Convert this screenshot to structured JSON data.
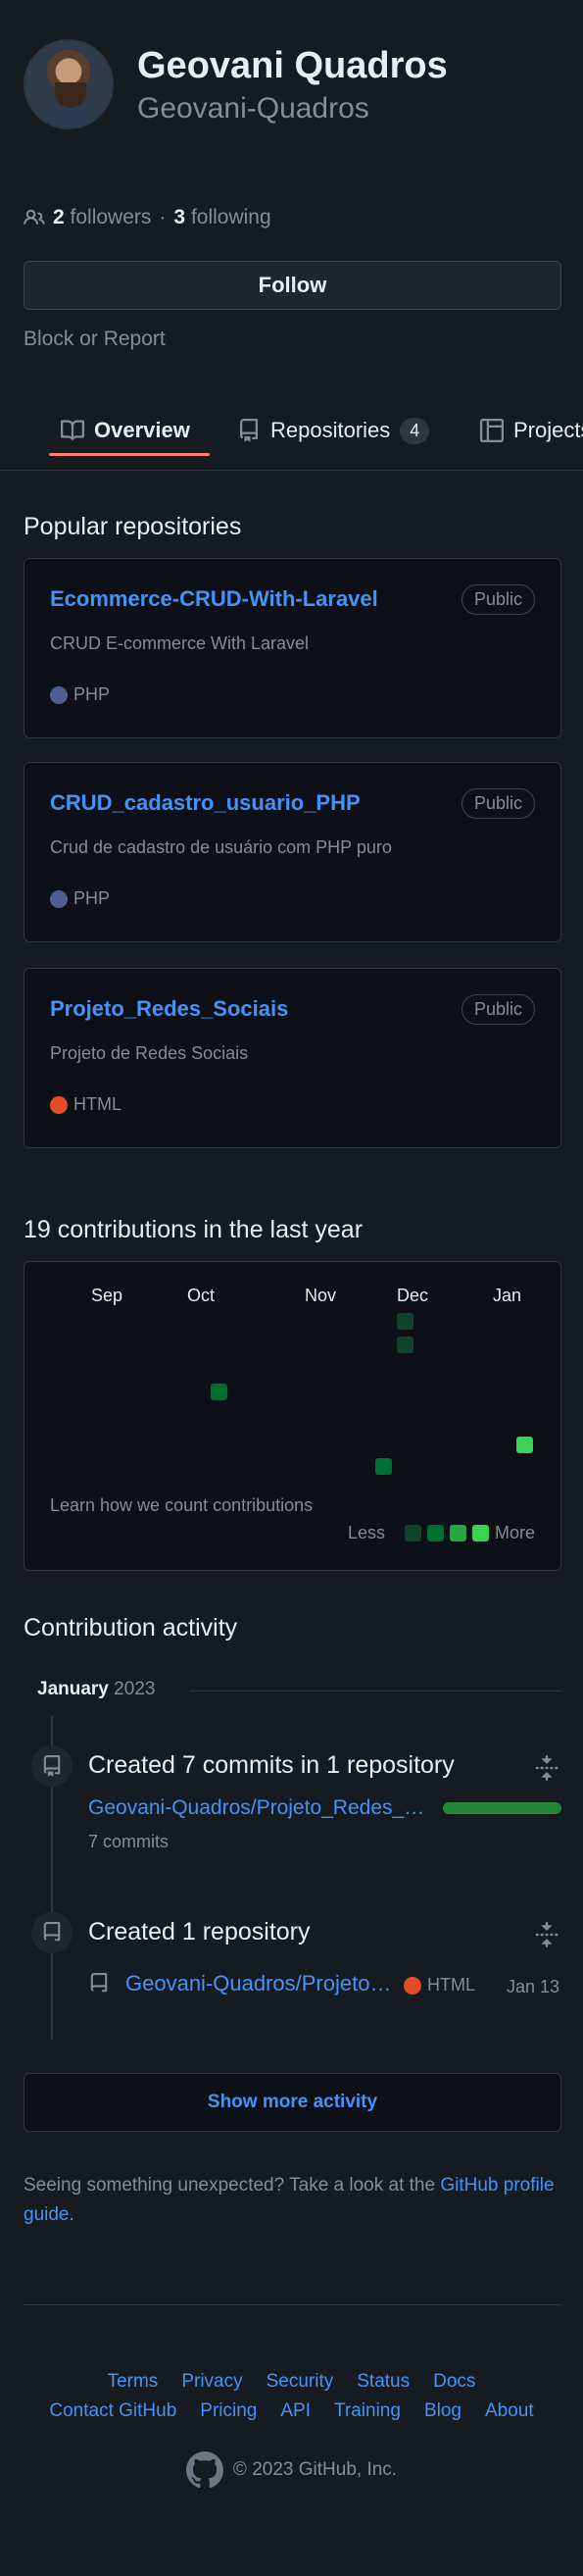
{
  "profile": {
    "name": "Geovani Quadros",
    "login": "Geovani-Quadros",
    "followers_count": "2",
    "followers_label": "followers",
    "separator": "·",
    "following_count": "3",
    "following_label": "following",
    "follow_button": "Follow",
    "block_report": "Block or Report"
  },
  "tabs": [
    {
      "label": "Overview",
      "icon": "book-icon"
    },
    {
      "label": "Repositories",
      "icon": "repo-icon",
      "count": "4"
    },
    {
      "label": "Projects",
      "icon": "project-icon"
    }
  ],
  "popular": {
    "title": "Popular repositories",
    "repos": [
      {
        "name": "Ecommerce-CRUD-With-Laravel",
        "visibility": "Public",
        "description": "CRUD E-commerce With Laravel",
        "language": "PHP",
        "language_color": "#4F5D95"
      },
      {
        "name": "CRUD_cadastro_usuario_PHP",
        "visibility": "Public",
        "description": "Crud de cadastro de usuário com PHP puro",
        "language": "PHP",
        "language_color": "#4F5D95"
      },
      {
        "name": "Projeto_Redes_Sociais",
        "visibility": "Public",
        "description": "Projeto de Redes Sociais",
        "language": "HTML",
        "language_color": "#e34c26"
      }
    ]
  },
  "contributions": {
    "title": "19 contributions in the last year",
    "months": [
      "Sep",
      "Oct",
      "Nov",
      "Dec",
      "Jan"
    ],
    "learn": "Learn how we count contributions",
    "less": "Less",
    "more": "More",
    "colors": [
      "#0e4429",
      "#006d32",
      "#26a641",
      "#39d353"
    ]
  },
  "activity": {
    "title": "Contribution activity",
    "month": "January",
    "year": "2023",
    "items": [
      {
        "title": "Created 7 commits in 1 repository",
        "repo": "Geovani-Quadros/Projeto_Redes_Sociais",
        "sub": "7 commits"
      },
      {
        "title": "Created 1 repository",
        "repo": "Geovani-Quadros/Projeto_Redes_Sociais",
        "language": "HTML",
        "language_color": "#e34c26",
        "date": "Jan 13"
      }
    ],
    "show_more": "Show more activity"
  },
  "unexpected": {
    "text": "Seeing something unexpected? Take a look at the ",
    "link": "GitHub profile guide",
    "end": "."
  },
  "footer": {
    "row1": [
      "Terms",
      "Privacy",
      "Security",
      "Status",
      "Docs"
    ],
    "row2": [
      "Contact GitHub",
      "Pricing",
      "API",
      "Training",
      "Blog",
      "About"
    ],
    "copyright": "© 2023 GitHub, Inc."
  }
}
